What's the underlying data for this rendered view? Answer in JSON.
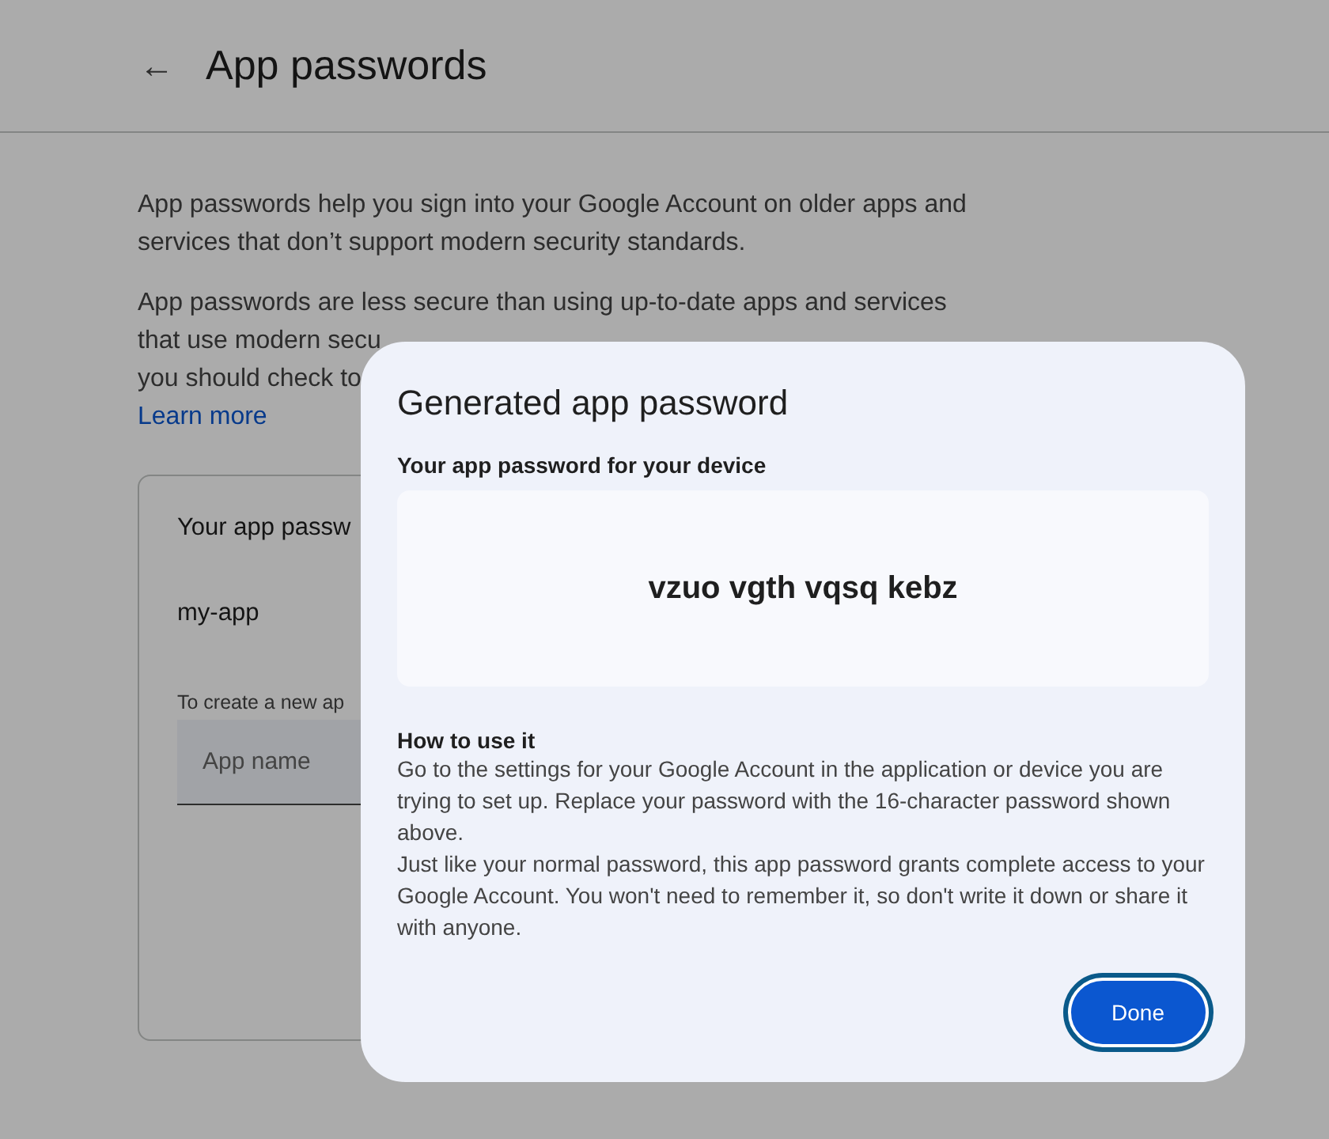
{
  "header": {
    "back": "←",
    "title": "App passwords"
  },
  "intro": [
    "App passwords help you sign into your Google Account on older apps and services that don’t support modern security standards.",
    [
      "App passwords are less secure than using up-to-date apps and services",
      "that use modern secu",
      "you should check to"
    ]
  ],
  "learn_more": "Learn more",
  "card": {
    "title": "Your app passw",
    "apps": [
      "my-app"
    ],
    "create_hint": "To create a new ap",
    "app_name": {
      "placeholder": "App name"
    }
  },
  "dialog": {
    "title": "Generated app password",
    "password_label": "Your app password for your device",
    "password": "vzuo vgth vqsq kebz",
    "howto_title": "How to use it",
    "howto": [
      "Go to the settings for your Google Account in the application or device you are trying to set up. Replace your password with the 16-character password shown above.",
      "Just like your normal password, this app password grants complete access to your Google Account. You won't need to remember it, so don't write it down or share it with anyone."
    ],
    "button": "Done"
  }
}
